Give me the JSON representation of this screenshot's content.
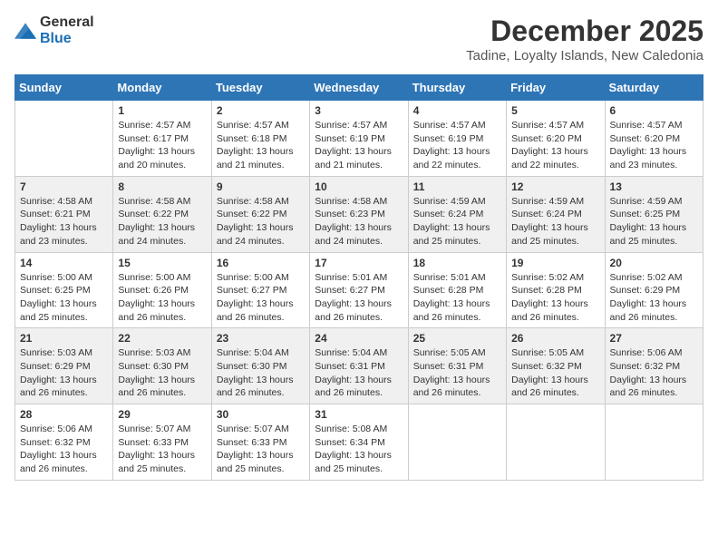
{
  "logo": {
    "general": "General",
    "blue": "Blue"
  },
  "title": "December 2025",
  "location": "Tadine, Loyalty Islands, New Caledonia",
  "weekdays": [
    "Sunday",
    "Monday",
    "Tuesday",
    "Wednesday",
    "Thursday",
    "Friday",
    "Saturday"
  ],
  "weeks": [
    [
      {
        "day": "",
        "info": ""
      },
      {
        "day": "1",
        "info": "Sunrise: 4:57 AM\nSunset: 6:17 PM\nDaylight: 13 hours\nand 20 minutes."
      },
      {
        "day": "2",
        "info": "Sunrise: 4:57 AM\nSunset: 6:18 PM\nDaylight: 13 hours\nand 21 minutes."
      },
      {
        "day": "3",
        "info": "Sunrise: 4:57 AM\nSunset: 6:19 PM\nDaylight: 13 hours\nand 21 minutes."
      },
      {
        "day": "4",
        "info": "Sunrise: 4:57 AM\nSunset: 6:19 PM\nDaylight: 13 hours\nand 22 minutes."
      },
      {
        "day": "5",
        "info": "Sunrise: 4:57 AM\nSunset: 6:20 PM\nDaylight: 13 hours\nand 22 minutes."
      },
      {
        "day": "6",
        "info": "Sunrise: 4:57 AM\nSunset: 6:20 PM\nDaylight: 13 hours\nand 23 minutes."
      }
    ],
    [
      {
        "day": "7",
        "info": "Sunrise: 4:58 AM\nSunset: 6:21 PM\nDaylight: 13 hours\nand 23 minutes."
      },
      {
        "day": "8",
        "info": "Sunrise: 4:58 AM\nSunset: 6:22 PM\nDaylight: 13 hours\nand 24 minutes."
      },
      {
        "day": "9",
        "info": "Sunrise: 4:58 AM\nSunset: 6:22 PM\nDaylight: 13 hours\nand 24 minutes."
      },
      {
        "day": "10",
        "info": "Sunrise: 4:58 AM\nSunset: 6:23 PM\nDaylight: 13 hours\nand 24 minutes."
      },
      {
        "day": "11",
        "info": "Sunrise: 4:59 AM\nSunset: 6:24 PM\nDaylight: 13 hours\nand 25 minutes."
      },
      {
        "day": "12",
        "info": "Sunrise: 4:59 AM\nSunset: 6:24 PM\nDaylight: 13 hours\nand 25 minutes."
      },
      {
        "day": "13",
        "info": "Sunrise: 4:59 AM\nSunset: 6:25 PM\nDaylight: 13 hours\nand 25 minutes."
      }
    ],
    [
      {
        "day": "14",
        "info": "Sunrise: 5:00 AM\nSunset: 6:25 PM\nDaylight: 13 hours\nand 25 minutes."
      },
      {
        "day": "15",
        "info": "Sunrise: 5:00 AM\nSunset: 6:26 PM\nDaylight: 13 hours\nand 26 minutes."
      },
      {
        "day": "16",
        "info": "Sunrise: 5:00 AM\nSunset: 6:27 PM\nDaylight: 13 hours\nand 26 minutes."
      },
      {
        "day": "17",
        "info": "Sunrise: 5:01 AM\nSunset: 6:27 PM\nDaylight: 13 hours\nand 26 minutes."
      },
      {
        "day": "18",
        "info": "Sunrise: 5:01 AM\nSunset: 6:28 PM\nDaylight: 13 hours\nand 26 minutes."
      },
      {
        "day": "19",
        "info": "Sunrise: 5:02 AM\nSunset: 6:28 PM\nDaylight: 13 hours\nand 26 minutes."
      },
      {
        "day": "20",
        "info": "Sunrise: 5:02 AM\nSunset: 6:29 PM\nDaylight: 13 hours\nand 26 minutes."
      }
    ],
    [
      {
        "day": "21",
        "info": "Sunrise: 5:03 AM\nSunset: 6:29 PM\nDaylight: 13 hours\nand 26 minutes."
      },
      {
        "day": "22",
        "info": "Sunrise: 5:03 AM\nSunset: 6:30 PM\nDaylight: 13 hours\nand 26 minutes."
      },
      {
        "day": "23",
        "info": "Sunrise: 5:04 AM\nSunset: 6:30 PM\nDaylight: 13 hours\nand 26 minutes."
      },
      {
        "day": "24",
        "info": "Sunrise: 5:04 AM\nSunset: 6:31 PM\nDaylight: 13 hours\nand 26 minutes."
      },
      {
        "day": "25",
        "info": "Sunrise: 5:05 AM\nSunset: 6:31 PM\nDaylight: 13 hours\nand 26 minutes."
      },
      {
        "day": "26",
        "info": "Sunrise: 5:05 AM\nSunset: 6:32 PM\nDaylight: 13 hours\nand 26 minutes."
      },
      {
        "day": "27",
        "info": "Sunrise: 5:06 AM\nSunset: 6:32 PM\nDaylight: 13 hours\nand 26 minutes."
      }
    ],
    [
      {
        "day": "28",
        "info": "Sunrise: 5:06 AM\nSunset: 6:32 PM\nDaylight: 13 hours\nand 26 minutes."
      },
      {
        "day": "29",
        "info": "Sunrise: 5:07 AM\nSunset: 6:33 PM\nDaylight: 13 hours\nand 25 minutes."
      },
      {
        "day": "30",
        "info": "Sunrise: 5:07 AM\nSunset: 6:33 PM\nDaylight: 13 hours\nand 25 minutes."
      },
      {
        "day": "31",
        "info": "Sunrise: 5:08 AM\nSunset: 6:34 PM\nDaylight: 13 hours\nand 25 minutes."
      },
      {
        "day": "",
        "info": ""
      },
      {
        "day": "",
        "info": ""
      },
      {
        "day": "",
        "info": ""
      }
    ]
  ]
}
